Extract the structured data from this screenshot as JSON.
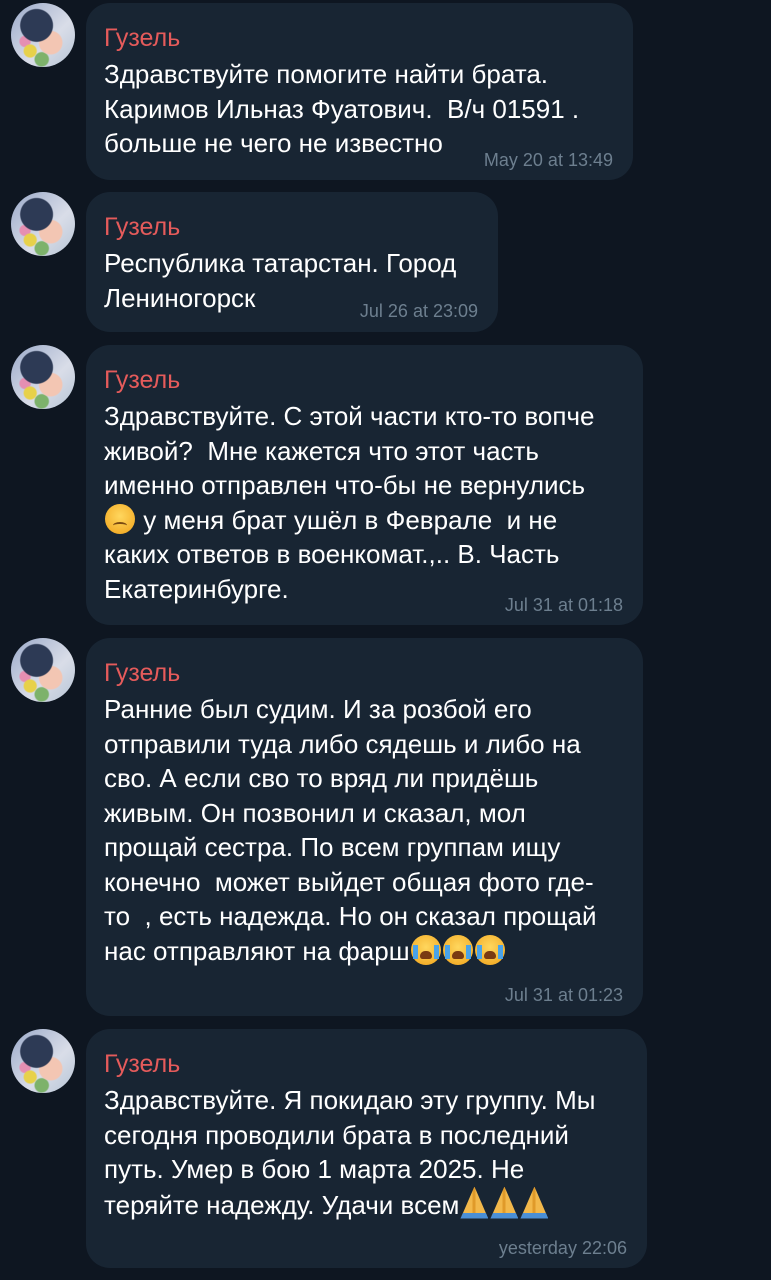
{
  "messages": [
    {
      "sender": "Гузель",
      "lines": [
        "Здравствуйте помогите найти брата.",
        "Каримов Ильназ Фуатович.  В/ч 01591 .",
        "больше не чего не известно"
      ],
      "time": "May 20 at 13:49"
    },
    {
      "sender": "Гузель",
      "lines": [
        "Республика татарстан. Город",
        "Лениногорск"
      ],
      "time": "Jul 26 at 23:09"
    },
    {
      "sender": "Гузель",
      "lines": [
        "Здравствуйте. С этой части кто-то вопче",
        "живой?  Мне кажется что этот часть",
        "именно отправлен что-бы не вернулись",
        " у меня брат ушёл в Феврале  и не",
        "каких ответов в военкомат.,.. В. Часть",
        "Екатеринбурге."
      ],
      "time": "Jul 31 at 01:18",
      "emoji": "pensive-face-icon"
    },
    {
      "sender": "Гузель",
      "lines": [
        "Ранние был судим. И за розбой его",
        "отправили туда либо сядешь и либо на",
        "сво. А если сво то вряд ли придёшь",
        "живым. Он позвонил и сказал, мол",
        "прощай сестра. По всем группам ищу",
        "конечно  может выйдет общая фото где-",
        "то  , есть надежда. Но он сказал прощай",
        "нас отправляют на фарш"
      ],
      "time": "Jul 31 at 01:23",
      "emoji": "loudly-crying-face-icon"
    },
    {
      "sender": "Гузель",
      "lines": [
        "Здравствуйте. Я покидаю эту группу. Мы",
        "сегодня проводили брата в последний",
        "путь. Умер в бою 1 марта 2025. Не",
        "теряйте надежду. Удачи всем"
      ],
      "time": "yesterday 22:06",
      "emoji": "folded-hands-icon"
    }
  ]
}
